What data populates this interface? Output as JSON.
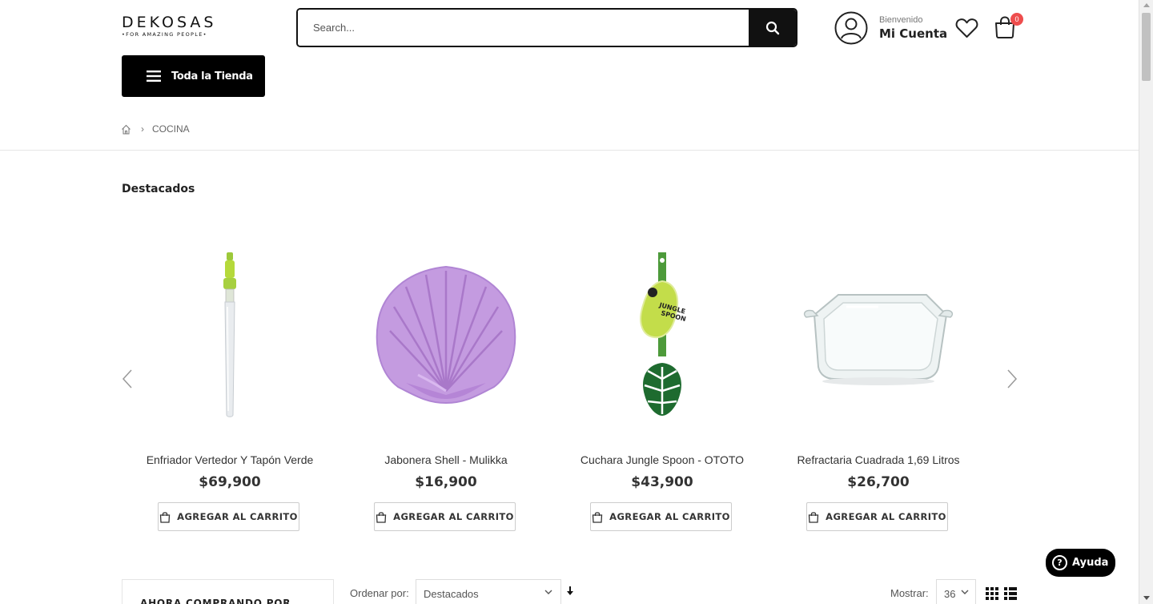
{
  "header": {
    "logo_main": "DEKOSAS",
    "logo_sub": "•FOR AMAZING PEOPLE•",
    "search_placeholder": "Search...",
    "account_greeting": "Bienvenido",
    "account_label": "Mi Cuenta",
    "cart_count": "0",
    "store_button": "Toda la Tienda"
  },
  "breadcrumb": {
    "current": "COCINA"
  },
  "section": {
    "title": "Destacados"
  },
  "products": [
    {
      "name": "Enfriador Vertedor Y Tapón Verde",
      "price": "$69,900",
      "button": "AGREGAR AL CARRITO"
    },
    {
      "name": "Jabonera Shell - Mulikka",
      "price": "$16,900",
      "button": "AGREGAR AL CARRITO"
    },
    {
      "name": "Cuchara Jungle Spoon - OTOTO",
      "price": "$43,900",
      "button": "AGREGAR AL CARRITO"
    },
    {
      "name": "Refractaria Cuadrada 1,69 Litros",
      "price": "$26,700",
      "button": "AGREGAR AL CARRITO"
    }
  ],
  "toolbar": {
    "filter_heading": "AHORA COMPRANDO POR",
    "order_label": "Ordenar por:",
    "order_value": "Destacados",
    "show_label": "Mostrar:",
    "show_value": "36"
  },
  "help": {
    "label": "Ayuda"
  },
  "colors": {
    "accent": "#000000",
    "badge": "#ee4d4d",
    "lavender": "#c49be0",
    "lime": "#b5d93b",
    "leaf_green": "#1e6b2f"
  },
  "icons": [
    "search-icon",
    "user-icon",
    "heart-icon",
    "bag-icon",
    "menu-icon",
    "home-icon",
    "chevron-left-icon",
    "chevron-right-icon",
    "cart-icon",
    "grid-icon",
    "list-icon",
    "question-icon"
  ]
}
